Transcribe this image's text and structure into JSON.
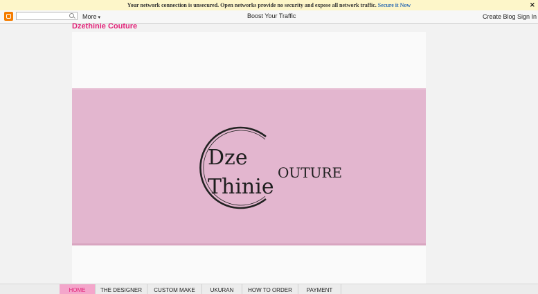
{
  "warning_bar": {
    "message": "Your network connection is unsecured. Open networks provide no security and expose all network traffic.",
    "link": "Secure it Now",
    "close": "×"
  },
  "navbar": {
    "search_placeholder": "",
    "more": "More",
    "more_caret": "▾",
    "boost": "Boost Your Traffic",
    "create_blog": "Create Blog",
    "sign_in": "Sign In"
  },
  "blog": {
    "title": "Dzethinie Couture",
    "title_color": "#e2257a"
  },
  "banner": {
    "logo_line1": "Dze",
    "logo_line2": "Thinie",
    "logo_side": "OUTURE",
    "background_color": "#e3b6cf"
  },
  "tabs": [
    {
      "label": "HOME",
      "active": true
    },
    {
      "label": "THE DESIGNER",
      "active": false
    },
    {
      "label": "CUSTOM MAKE",
      "active": false
    },
    {
      "label": "UKURAN",
      "active": false
    },
    {
      "label": "HOW TO ORDER",
      "active": false
    },
    {
      "label": "PAYMENT",
      "active": false
    }
  ],
  "colors": {
    "accent": "#e2257a",
    "active_tab": "#f4a6cb",
    "blogger": "#f57d00"
  }
}
